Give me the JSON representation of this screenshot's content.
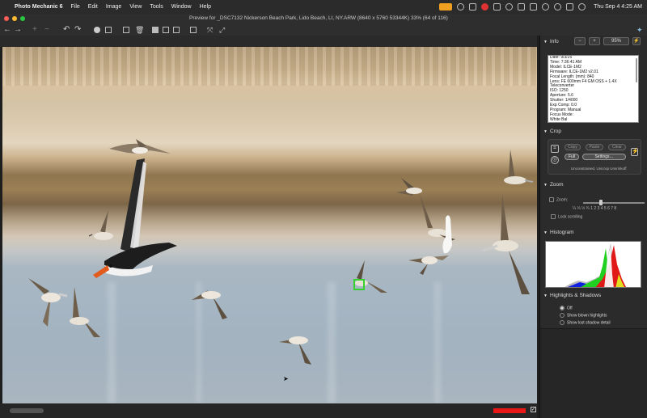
{
  "menubar": {
    "app_name": "Photo Mechanic 6",
    "items": [
      "File",
      "Edit",
      "Image",
      "View",
      "Tools",
      "Window",
      "Help"
    ],
    "clock": "Thu Sep 4  4:25 AM"
  },
  "window": {
    "title": "Preview for  _DSC7132 Nickerson Beach Park, Lido Beach, LI, NY.ARW (8640 x 5760 53344K) 33% (64 of 116)"
  },
  "panel": {
    "info": {
      "title": "Info",
      "minus": "−",
      "plus": "+",
      "zoom_value": "95%",
      "lines": [
        "Date: 9/3/25",
        "Time: 7:36:41 AM",
        "Model: ILCE-1M2",
        "Firmware: ILCE-1M2 v2.01",
        "Focal Length:  (mm): 840",
        "Lens: FE 600mm F4 GM OSS + 1.4X",
        "Teleconverter",
        "ISO: 1250",
        "Aperture: 5.6",
        "Shutter: 1/4000",
        "Exp Comp: 0.0",
        "Program: Manual",
        "Focus Mode:",
        "White Bal"
      ]
    },
    "crop": {
      "title": "Crop",
      "copy": "Copy",
      "paste": "Paste",
      "clear": "Clear",
      "full": "Full",
      "settings": "Settings…",
      "status": "Unconstrained, Unicrop Unsrinkoff"
    },
    "zoom": {
      "title": "Zoom",
      "zoom_label": "Zoom:",
      "scale": "¼  ⅓  ½  ¾  1  2  3  4  5  6  7  8",
      "lock": "Lock scrolling"
    },
    "histogram": {
      "title": "Histogram"
    },
    "highlights": {
      "title": "Highlights & Shadows",
      "options": [
        "Off",
        "Show blown highlights",
        "Show lost shadow detail"
      ]
    }
  }
}
